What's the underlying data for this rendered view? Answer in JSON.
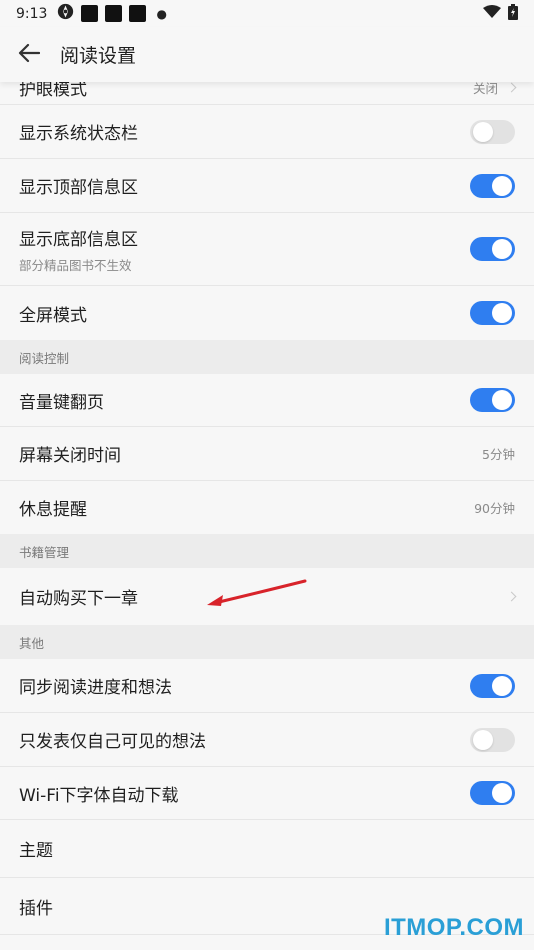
{
  "status_bar": {
    "time": "9:13"
  },
  "app_bar": {
    "title": "阅读设置"
  },
  "rows_top": [
    {
      "label": "护眼模式",
      "value": "关闭"
    },
    {
      "label": "显示系统状态栏",
      "toggle": "off"
    },
    {
      "label": "显示顶部信息区",
      "toggle": "on"
    },
    {
      "label": "显示底部信息区",
      "sub": "部分精品图书不生效",
      "toggle": "on"
    },
    {
      "label": "全屏模式",
      "toggle": "on"
    }
  ],
  "sections": [
    {
      "title": "阅读控制",
      "rows": [
        {
          "label": "音量键翻页",
          "toggle": "on"
        },
        {
          "label": "屏幕关闭时间",
          "value": "5分钟"
        },
        {
          "label": "休息提醒",
          "value": "90分钟"
        }
      ]
    },
    {
      "title": "书籍管理",
      "rows": [
        {
          "label": "自动购买下一章"
        }
      ]
    },
    {
      "title": "其他",
      "rows": [
        {
          "label": "同步阅读进度和想法",
          "toggle": "on"
        },
        {
          "label": "只发表仅自己可见的想法",
          "toggle": "off"
        },
        {
          "label": "Wi-Fi下字体自动下载",
          "toggle": "on"
        },
        {
          "label": "主题"
        },
        {
          "label": "插件"
        }
      ]
    }
  ],
  "colors": {
    "accent": "#2f7ef0",
    "toggle_off": "#e2e2e2",
    "annotation": "#d8232a",
    "watermark": "#2a9fd6"
  },
  "watermark": "ITMOP.COM"
}
